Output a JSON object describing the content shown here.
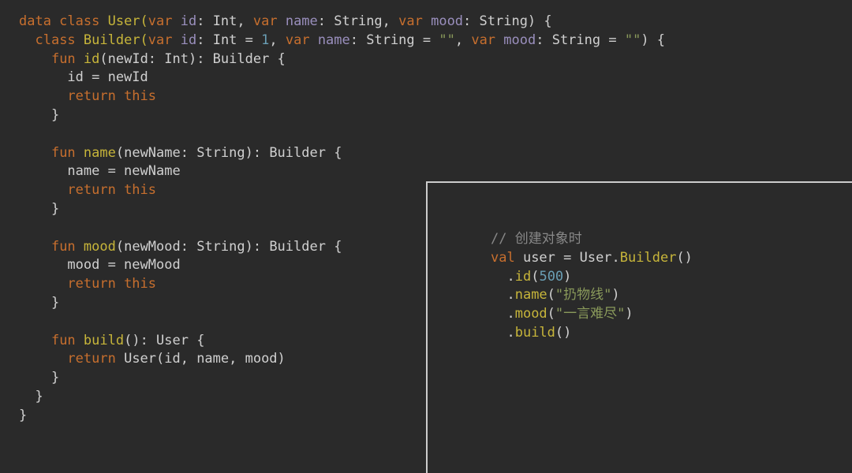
{
  "main": {
    "l01a": "data class ",
    "l01b": "User(",
    "l01c": "var ",
    "l01d": "id",
    "l01e": ": Int, ",
    "l01f": "var ",
    "l01g": "name",
    "l01h": ": String, ",
    "l01i": "var ",
    "l01j": "mood",
    "l01k": ": String) {",
    "l02a": "  ",
    "l02b": "class ",
    "l02c": "Builder(",
    "l02d": "var ",
    "l02e": "id",
    "l02f": ": Int = ",
    "l02g": "1",
    "l02h": ", ",
    "l02i": "var ",
    "l02j": "name",
    "l02k": ": String = ",
    "l02l": "\"\"",
    "l02m": ", ",
    "l02n": "var ",
    "l02o": "mood",
    "l02p": ": String = ",
    "l02q": "\"\"",
    "l02r": ") {",
    "l03a": "    ",
    "l03b": "fun ",
    "l03c": "id",
    "l03d": "(newId: Int): Builder {",
    "l04a": "      id = newId",
    "l05a": "      ",
    "l05b": "return this",
    "l06a": "    }",
    "l07a": "",
    "l08a": "    ",
    "l08b": "fun ",
    "l08c": "name",
    "l08d": "(newName: String): Builder {",
    "l09a": "      name = newName",
    "l10a": "      ",
    "l10b": "return this",
    "l11a": "    }",
    "l12a": "",
    "l13a": "    ",
    "l13b": "fun ",
    "l13c": "mood",
    "l13d": "(newMood: String): Builder {",
    "l14a": "      mood = newMood",
    "l15a": "      ",
    "l15b": "return this",
    "l16a": "    }",
    "l17a": "",
    "l18a": "    ",
    "l18b": "fun ",
    "l18c": "build",
    "l18d": "(): User {",
    "l19a": "      ",
    "l19b": "return ",
    "l19c": "User(id, name, mood)",
    "l20a": "    }",
    "l21a": "  }",
    "l22a": "}"
  },
  "inset": {
    "c1": "// 创建对象时",
    "c2a": "val ",
    "c2b": "user = User.",
    "c2c": "Builder",
    "c2d": "()",
    "c3a": "  .",
    "c3b": "id",
    "c3c": "(",
    "c3d": "500",
    "c3e": ")",
    "c4a": "  .",
    "c4b": "name",
    "c4c": "(",
    "c4d": "\"扔物线\"",
    "c4e": ")",
    "c5a": "  .",
    "c5b": "mood",
    "c5c": "(",
    "c5d": "\"一言难尽\"",
    "c5e": ")",
    "c6a": "  .",
    "c6b": "build",
    "c6c": "()"
  }
}
